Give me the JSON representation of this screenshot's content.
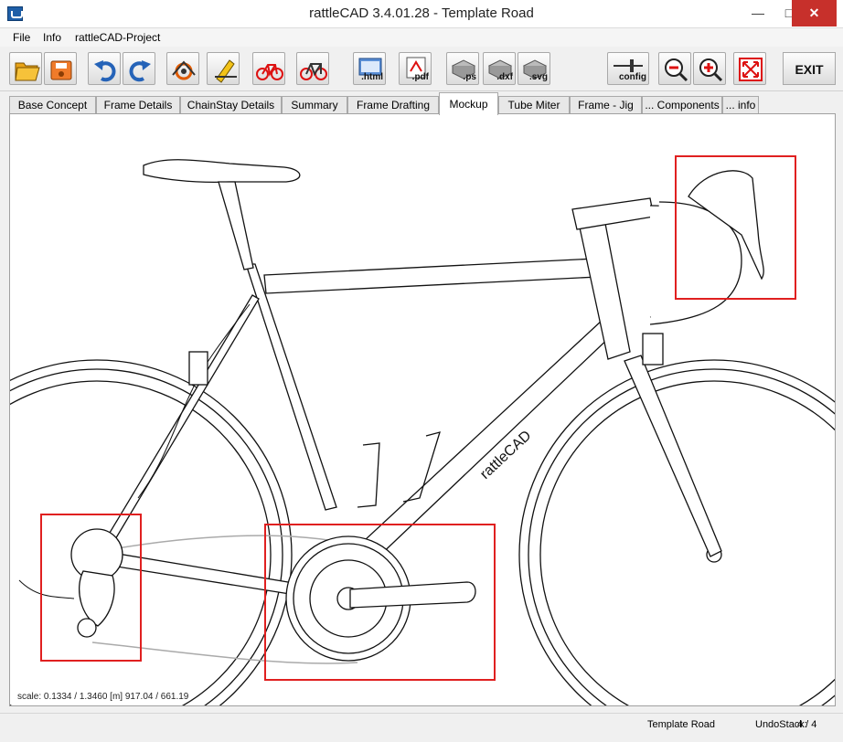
{
  "window": {
    "title": "rattleCAD  3.4.01.28 - Template Road",
    "minimize": "—",
    "maximize": "□",
    "close": "✕"
  },
  "menu": [
    "File",
    "Info",
    "rattleCAD-Project"
  ],
  "toolbar": {
    "buttons": [
      {
        "name": "open-icon"
      },
      {
        "name": "save-icon"
      },
      {
        "name": "undo-icon"
      },
      {
        "name": "redo-icon"
      },
      {
        "name": "frame-geometry-icon"
      },
      {
        "name": "pencil-icon"
      },
      {
        "name": "bike-red-icon"
      },
      {
        "name": "bike-red-alt-icon"
      },
      {
        "name": "export-html-icon",
        "label": ".html"
      },
      {
        "name": "export-pdf-icon",
        "label": ".pdf"
      },
      {
        "name": "export-ps-icon",
        "label": ".ps"
      },
      {
        "name": "export-dxf-icon",
        "label": ".dxf"
      },
      {
        "name": "export-svg-icon",
        "label": ".svg"
      },
      {
        "name": "config-icon",
        "label": "config"
      },
      {
        "name": "zoom-out-icon"
      },
      {
        "name": "zoom-in-icon"
      },
      {
        "name": "fit-icon"
      }
    ],
    "exit_label": "EXIT"
  },
  "tabs": [
    {
      "label": "Base Concept"
    },
    {
      "label": "Frame Details"
    },
    {
      "label": "ChainStay Details"
    },
    {
      "label": "Summary"
    },
    {
      "label": "Frame Drafting"
    },
    {
      "label": "Mockup",
      "active": true
    },
    {
      "label": "Tube Miter"
    },
    {
      "label": "Frame - Jig"
    },
    {
      "label": "... Components"
    },
    {
      "label": "... info"
    }
  ],
  "canvas": {
    "scale_text": "scale: 0.1334 / 1.3460  [m]  917.04 / 661.19",
    "logo_text": "rattleCAD",
    "accent": "#e02020"
  },
  "status": {
    "project": "Template Road",
    "undo_label": "UndoStack:",
    "undo_value": "4 /  4"
  }
}
